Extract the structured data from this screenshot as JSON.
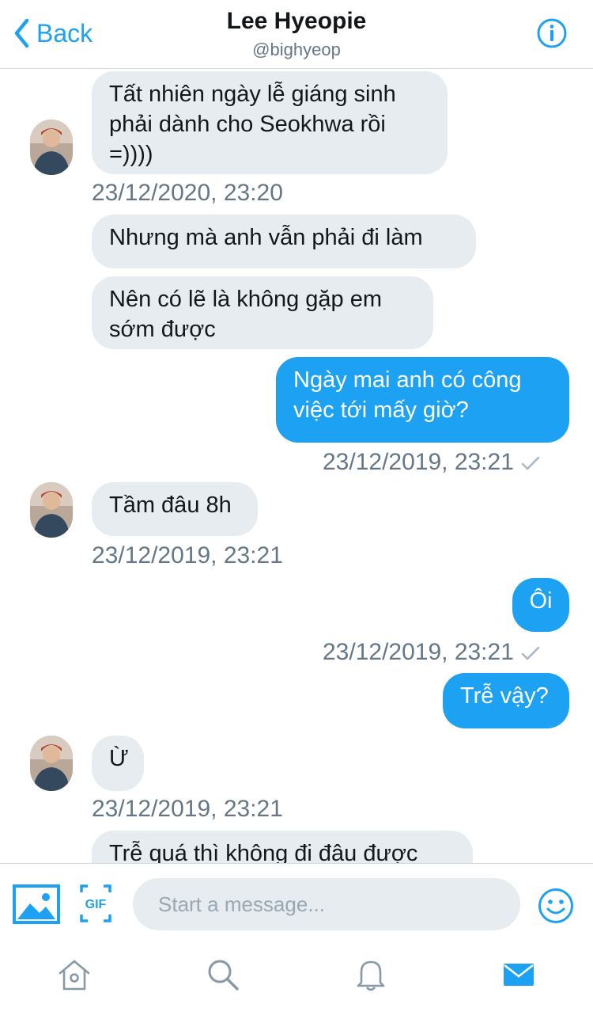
{
  "header": {
    "back_label": "Back",
    "name": "Lee Hyeopie",
    "handle": "@bighyeop"
  },
  "messages": [
    {
      "text": "Tất nhiên ngày lễ giáng sinh\nphải dành cho Seokhwa rồi\n=))))",
      "from": "them"
    },
    {
      "timestamp": "23/12/2020, 23:20"
    },
    {
      "text": "Nhưng mà anh vẫn phải đi làm",
      "from": "them"
    },
    {
      "text": "Nên có lẽ là không gặp em\nsớm được",
      "from": "them"
    },
    {
      "text": "Ngày mai anh có công\nviệc tới mấy giờ?",
      "from": "me"
    },
    {
      "timestamp": "23/12/2019, 23:21"
    },
    {
      "text": "Tầm đâu 8h",
      "from": "them"
    },
    {
      "timestamp": "23/12/2019, 23:21"
    },
    {
      "text": "Ôi",
      "from": "me"
    },
    {
      "timestamp": "23/12/2019, 23:21"
    },
    {
      "text": "Trễ vậy?",
      "from": "me"
    },
    {
      "text": "Ừ",
      "from": "them"
    },
    {
      "timestamp": "23/12/2019, 23:21"
    },
    {
      "text": "Trễ quá thì không đi đâu được",
      "from": "them"
    }
  ],
  "composer": {
    "placeholder": "Start a message...",
    "gif_label": "GIF"
  },
  "tabs": [
    {
      "icon": "home-icon",
      "active": false
    },
    {
      "icon": "search-icon",
      "active": false
    },
    {
      "icon": "bell-icon",
      "active": false
    },
    {
      "icon": "mail-icon",
      "active": true
    }
  ],
  "colors": {
    "accent": "#1da1f2",
    "incoming_bubble": "#e6ecf0",
    "muted": "#657786"
  }
}
